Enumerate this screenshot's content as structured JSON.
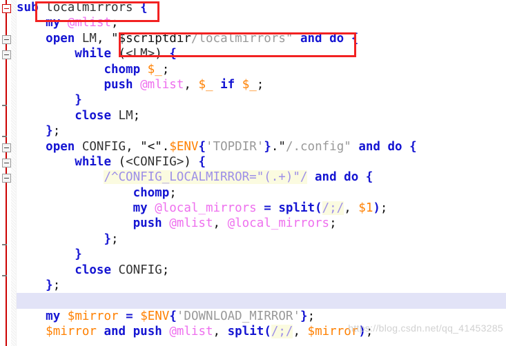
{
  "editor": {
    "app": "code-editor",
    "language": "Perl",
    "background": "#ffffff",
    "current_line_highlight": "#e2e3f7",
    "annotation_color": "#f22121",
    "colors": {
      "keyword": "#1414d2",
      "scalar_variable": "#ff8000",
      "array_variable": "#ee6fee",
      "string": "#999999",
      "regex_text": "#9d8fe8",
      "regex_background": "#fbfbe0",
      "identifier": "#333333",
      "fold_marker_active": "#cc0000"
    }
  },
  "watermark": {
    "text": "https://blog.csdn.net/qq_41453285"
  },
  "annotations": [
    {
      "name": "sub-name-highlight",
      "label": "localmirrors"
    },
    {
      "name": "string-path-highlight",
      "label": "\"$scriptdir/localmirrors\""
    }
  ],
  "gutter": {
    "fold_markers": [
      {
        "type": "collapse-box-active",
        "line": 0
      },
      {
        "type": "collapse-box",
        "line": 2
      },
      {
        "type": "collapse-box",
        "line": 3
      },
      {
        "type": "fold-end-tick",
        "line": 6
      },
      {
        "type": "fold-end-tick",
        "line": 8
      },
      {
        "type": "collapse-box",
        "line": 9
      },
      {
        "type": "collapse-box",
        "line": 10
      },
      {
        "type": "collapse-box",
        "line": 11
      },
      {
        "type": "fold-end-tick",
        "line": 15
      },
      {
        "type": "fold-end-tick",
        "line": 17
      }
    ]
  },
  "code": {
    "lines": [
      {
        "id": "line-1",
        "text": "sub localmirrors {",
        "tokens": [
          {
            "t": "sub",
            "c": "kw"
          },
          {
            "t": " ",
            "c": "plain"
          },
          {
            "t": "localmirrors",
            "c": "id"
          },
          {
            "t": " ",
            "c": "plain"
          },
          {
            "t": "{",
            "c": "kw"
          }
        ]
      },
      {
        "id": "line-2",
        "text": "    my @mlist;",
        "tokens": [
          {
            "t": "    ",
            "c": "plain"
          },
          {
            "t": "my",
            "c": "kw"
          },
          {
            "t": " ",
            "c": "plain"
          },
          {
            "t": "@mlist",
            "c": "arr"
          },
          {
            "t": ";",
            "c": "plain"
          }
        ]
      },
      {
        "id": "line-3",
        "text": "    open LM, \"$scriptdir/localmirrors\" and do {",
        "tokens": [
          {
            "t": "    ",
            "c": "plain"
          },
          {
            "t": "open",
            "c": "kw"
          },
          {
            "t": " ",
            "c": "plain"
          },
          {
            "t": "LM",
            "c": "id"
          },
          {
            "t": ", ",
            "c": "plain"
          },
          {
            "t": "\"$scriptdir",
            "c": "strq"
          },
          {
            "t": "/localmirrors\"",
            "c": "str"
          },
          {
            "t": " ",
            "c": "plain"
          },
          {
            "t": "and",
            "c": "kw"
          },
          {
            "t": " ",
            "c": "plain"
          },
          {
            "t": "do",
            "c": "kw"
          },
          {
            "t": " ",
            "c": "plain"
          },
          {
            "t": "{",
            "c": "kw"
          }
        ]
      },
      {
        "id": "line-4",
        "text": "        while (<LM>) {",
        "tokens": [
          {
            "t": "        ",
            "c": "plain"
          },
          {
            "t": "while",
            "c": "kw"
          },
          {
            "t": " (",
            "c": "plain"
          },
          {
            "t": "<LM>",
            "c": "id"
          },
          {
            "t": ") ",
            "c": "plain"
          },
          {
            "t": "{",
            "c": "kw"
          }
        ]
      },
      {
        "id": "line-5",
        "text": "            chomp $_;",
        "tokens": [
          {
            "t": "            ",
            "c": "plain"
          },
          {
            "t": "chomp",
            "c": "kw"
          },
          {
            "t": " ",
            "c": "plain"
          },
          {
            "t": "$_",
            "c": "var"
          },
          {
            "t": ";",
            "c": "plain"
          }
        ]
      },
      {
        "id": "line-6",
        "text": "            push @mlist, $_ if $_;",
        "tokens": [
          {
            "t": "            ",
            "c": "plain"
          },
          {
            "t": "push",
            "c": "kw"
          },
          {
            "t": " ",
            "c": "plain"
          },
          {
            "t": "@mlist",
            "c": "arr"
          },
          {
            "t": ", ",
            "c": "plain"
          },
          {
            "t": "$_",
            "c": "var"
          },
          {
            "t": " ",
            "c": "plain"
          },
          {
            "t": "if",
            "c": "kw"
          },
          {
            "t": " ",
            "c": "plain"
          },
          {
            "t": "$_",
            "c": "var"
          },
          {
            "t": ";",
            "c": "plain"
          }
        ]
      },
      {
        "id": "line-7",
        "text": "        }",
        "tokens": [
          {
            "t": "        ",
            "c": "plain"
          },
          {
            "t": "}",
            "c": "kw"
          }
        ]
      },
      {
        "id": "line-8",
        "text": "        close LM;",
        "tokens": [
          {
            "t": "        ",
            "c": "plain"
          },
          {
            "t": "close",
            "c": "kw"
          },
          {
            "t": " ",
            "c": "plain"
          },
          {
            "t": "LM",
            "c": "id"
          },
          {
            "t": ";",
            "c": "plain"
          }
        ]
      },
      {
        "id": "line-9",
        "text": "    };",
        "tokens": [
          {
            "t": "    ",
            "c": "plain"
          },
          {
            "t": "}",
            "c": "kw"
          },
          {
            "t": ";",
            "c": "plain"
          }
        ]
      },
      {
        "id": "line-10",
        "text": "    open CONFIG, \"<\".$ENV{'TOPDIR'}.\"/.config\" and do {",
        "tokens": [
          {
            "t": "    ",
            "c": "plain"
          },
          {
            "t": "open",
            "c": "kw"
          },
          {
            "t": " ",
            "c": "plain"
          },
          {
            "t": "CONFIG",
            "c": "id"
          },
          {
            "t": ", ",
            "c": "plain"
          },
          {
            "t": "\"<\"",
            "c": "strq"
          },
          {
            "t": ".",
            "c": "plain"
          },
          {
            "t": "$ENV",
            "c": "var"
          },
          {
            "t": "{",
            "c": "kw"
          },
          {
            "t": "'TOPDIR'",
            "c": "str"
          },
          {
            "t": "}",
            "c": "kw"
          },
          {
            "t": ".\"",
            "c": "plain"
          },
          {
            "t": "/.config\"",
            "c": "str"
          },
          {
            "t": " ",
            "c": "plain"
          },
          {
            "t": "and",
            "c": "kw"
          },
          {
            "t": " ",
            "c": "plain"
          },
          {
            "t": "do",
            "c": "kw"
          },
          {
            "t": " ",
            "c": "plain"
          },
          {
            "t": "{",
            "c": "kw"
          }
        ]
      },
      {
        "id": "line-11",
        "text": "        while (<CONFIG>) {",
        "tokens": [
          {
            "t": "        ",
            "c": "plain"
          },
          {
            "t": "while",
            "c": "kw"
          },
          {
            "t": " (",
            "c": "plain"
          },
          {
            "t": "<CONFIG>",
            "c": "id"
          },
          {
            "t": ") ",
            "c": "plain"
          },
          {
            "t": "{",
            "c": "kw"
          }
        ]
      },
      {
        "id": "line-12",
        "text": "            /^CONFIG_LOCALMIRROR=\"(.+)\"/ and do {",
        "tokens": [
          {
            "t": "            ",
            "c": "plain"
          },
          {
            "t": "/^CONFIG_LOCALMIRROR=\"(.+)\"/",
            "c": "rx"
          },
          {
            "t": " ",
            "c": "plain"
          },
          {
            "t": "and",
            "c": "kw"
          },
          {
            "t": " ",
            "c": "plain"
          },
          {
            "t": "do",
            "c": "kw"
          },
          {
            "t": " ",
            "c": "plain"
          },
          {
            "t": "{",
            "c": "kw"
          }
        ]
      },
      {
        "id": "line-13",
        "text": "                chomp;",
        "tokens": [
          {
            "t": "                ",
            "c": "plain"
          },
          {
            "t": "chomp",
            "c": "kw"
          },
          {
            "t": ";",
            "c": "plain"
          }
        ]
      },
      {
        "id": "line-14",
        "text": "                my @local_mirrors = split(/;/, $1);",
        "tokens": [
          {
            "t": "                ",
            "c": "plain"
          },
          {
            "t": "my",
            "c": "kw"
          },
          {
            "t": " ",
            "c": "plain"
          },
          {
            "t": "@local_mirrors",
            "c": "arr"
          },
          {
            "t": " ",
            "c": "plain"
          },
          {
            "t": "=",
            "c": "kw"
          },
          {
            "t": " ",
            "c": "plain"
          },
          {
            "t": "split",
            "c": "kw"
          },
          {
            "t": "(",
            "c": "kw"
          },
          {
            "t": "/;/",
            "c": "rx"
          },
          {
            "t": ", ",
            "c": "plain"
          },
          {
            "t": "$1",
            "c": "var"
          },
          {
            "t": ")",
            "c": "kw"
          },
          {
            "t": ";",
            "c": "plain"
          }
        ]
      },
      {
        "id": "line-15",
        "text": "                push @mlist, @local_mirrors;",
        "tokens": [
          {
            "t": "                ",
            "c": "plain"
          },
          {
            "t": "push",
            "c": "kw"
          },
          {
            "t": " ",
            "c": "plain"
          },
          {
            "t": "@mlist",
            "c": "arr"
          },
          {
            "t": ", ",
            "c": "plain"
          },
          {
            "t": "@local_mirrors",
            "c": "arr"
          },
          {
            "t": ";",
            "c": "plain"
          }
        ]
      },
      {
        "id": "line-16",
        "text": "            };",
        "tokens": [
          {
            "t": "            ",
            "c": "plain"
          },
          {
            "t": "}",
            "c": "kw"
          },
          {
            "t": ";",
            "c": "plain"
          }
        ]
      },
      {
        "id": "line-17",
        "text": "        }",
        "tokens": [
          {
            "t": "        ",
            "c": "plain"
          },
          {
            "t": "}",
            "c": "kw"
          }
        ]
      },
      {
        "id": "line-18",
        "text": "        close CONFIG;",
        "tokens": [
          {
            "t": "        ",
            "c": "plain"
          },
          {
            "t": "close",
            "c": "kw"
          },
          {
            "t": " ",
            "c": "plain"
          },
          {
            "t": "CONFIG",
            "c": "id"
          },
          {
            "t": ";",
            "c": "plain"
          }
        ]
      },
      {
        "id": "line-19",
        "text": "    };",
        "tokens": [
          {
            "t": "    ",
            "c": "plain"
          },
          {
            "t": "}",
            "c": "kw"
          },
          {
            "t": ";",
            "c": "plain"
          }
        ]
      },
      {
        "id": "line-20",
        "text": "",
        "current": true,
        "tokens": []
      },
      {
        "id": "line-21",
        "text": "    my $mirror = $ENV{'DOWNLOAD_MIRROR'};",
        "tokens": [
          {
            "t": "    ",
            "c": "plain"
          },
          {
            "t": "my",
            "c": "kw"
          },
          {
            "t": " ",
            "c": "plain"
          },
          {
            "t": "$mirror",
            "c": "var"
          },
          {
            "t": " ",
            "c": "plain"
          },
          {
            "t": "=",
            "c": "kw"
          },
          {
            "t": " ",
            "c": "plain"
          },
          {
            "t": "$ENV",
            "c": "var"
          },
          {
            "t": "{",
            "c": "kw"
          },
          {
            "t": "'DOWNLOAD_MIRROR'",
            "c": "str"
          },
          {
            "t": "}",
            "c": "kw"
          },
          {
            "t": ";",
            "c": "plain"
          }
        ]
      },
      {
        "id": "line-22",
        "text": "    $mirror and push @mlist, split(/;/, $mirror);",
        "tokens": [
          {
            "t": "    ",
            "c": "plain"
          },
          {
            "t": "$mirror",
            "c": "var"
          },
          {
            "t": " ",
            "c": "plain"
          },
          {
            "t": "and",
            "c": "kw"
          },
          {
            "t": " ",
            "c": "plain"
          },
          {
            "t": "push",
            "c": "kw"
          },
          {
            "t": " ",
            "c": "plain"
          },
          {
            "t": "@mlist",
            "c": "arr"
          },
          {
            "t": ", ",
            "c": "plain"
          },
          {
            "t": "split",
            "c": "kw"
          },
          {
            "t": "(",
            "c": "kw"
          },
          {
            "t": "/;/",
            "c": "rx"
          },
          {
            "t": ", ",
            "c": "plain"
          },
          {
            "t": "$mirror",
            "c": "var"
          },
          {
            "t": ")",
            "c": "kw"
          },
          {
            "t": ";",
            "c": "plain"
          }
        ]
      }
    ]
  }
}
